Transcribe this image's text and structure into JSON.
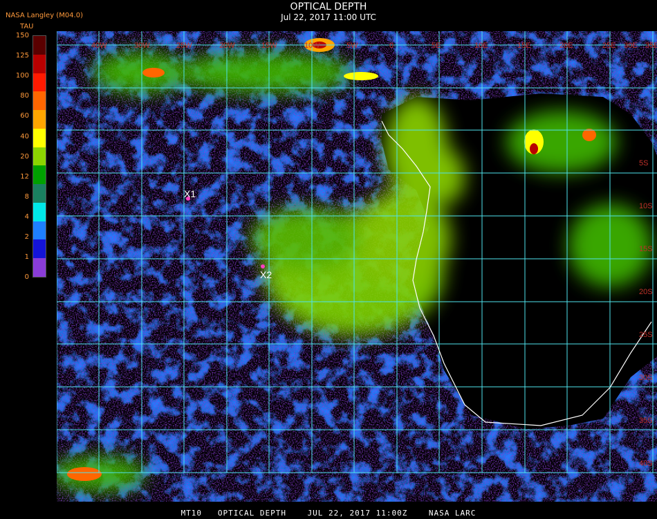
{
  "header": {
    "title": "OPTICAL DEPTH",
    "subtitle": "Jul 22, 2017 11:00 UTC",
    "source": "NASA Langley (M04.0)",
    "units": "TAU"
  },
  "colorbar": {
    "labels": [
      "150",
      "125",
      "100",
      "80",
      "60",
      "40",
      "20",
      "12",
      "8",
      "4",
      "2",
      "1",
      "0"
    ],
    "colors": [
      "#5a0000",
      "#b80000",
      "#ff1a00",
      "#ff6600",
      "#ffa500",
      "#ffff00",
      "#8cd400",
      "#00a000",
      "#1a8060",
      "#00e8e8",
      "#1e7fff",
      "#1414d8",
      "#8a3cd8"
    ]
  },
  "map": {
    "lon_labels": [
      "40W",
      "30W",
      "25W",
      "20W",
      "15W",
      "10W",
      "5W",
      "0",
      "5E",
      "10E",
      "15E",
      "20E",
      "25E",
      "30E",
      "35E"
    ],
    "lat_labels": [
      "5S",
      "10S",
      "15S",
      "20S",
      "25S",
      "30S",
      "35S",
      "40S"
    ],
    "markers": [
      {
        "label": "X1"
      },
      {
        "label": "X2"
      }
    ],
    "colors": {
      "grid": "#4fe3ee",
      "coast": "#ffffff",
      "tick_label": "#c0302a",
      "marker": "#ff40c0"
    }
  },
  "footer": "MT10   OPTICAL DEPTH    JUL 22, 2017 11:00Z    NASA LARC"
}
